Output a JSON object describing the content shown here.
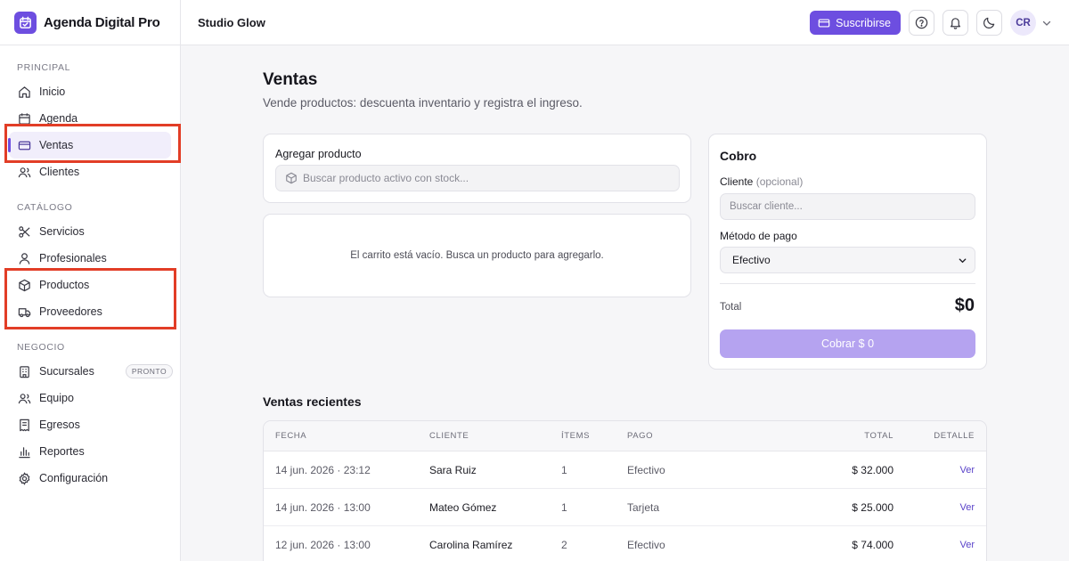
{
  "brand": {
    "name": "Agenda Digital Pro"
  },
  "topbar": {
    "studio": "Studio Glow",
    "subscribe_label": "Suscribirse",
    "avatar_initials": "CR"
  },
  "sidebar": {
    "sections": [
      {
        "label": "PRINCIPAL",
        "items": [
          {
            "label": "Inicio",
            "icon": "home-icon"
          },
          {
            "label": "Agenda",
            "icon": "calendar-icon"
          },
          {
            "label": "Ventas",
            "icon": "card-icon",
            "active": true
          },
          {
            "label": "Clientes",
            "icon": "user-icon"
          }
        ]
      },
      {
        "label": "CATÁLOGO",
        "items": [
          {
            "label": "Servicios",
            "icon": "scissors-icon"
          },
          {
            "label": "Profesionales",
            "icon": "person-icon"
          },
          {
            "label": "Productos",
            "icon": "box-icon"
          },
          {
            "label": "Proveedores",
            "icon": "truck-icon"
          }
        ]
      },
      {
        "label": "NEGOCIO",
        "items": [
          {
            "label": "Sucursales",
            "icon": "building-icon",
            "badge": "PRONTO"
          },
          {
            "label": "Equipo",
            "icon": "team-icon"
          },
          {
            "label": "Egresos",
            "icon": "receipt-icon"
          },
          {
            "label": "Reportes",
            "icon": "chart-icon"
          },
          {
            "label": "Configuración",
            "icon": "gear-icon"
          }
        ]
      }
    ]
  },
  "main": {
    "title": "Ventas",
    "subtitle": "Vende productos: descuenta inventario y registra el ingreso.",
    "add_product": {
      "label": "Agregar producto",
      "search_placeholder": "Buscar producto activo con stock..."
    },
    "cart_empty": "El carrito está vacío. Busca un producto para agregarlo.",
    "payment": {
      "title": "Cobro",
      "client_label": "Cliente",
      "client_optional": "(opcional)",
      "client_placeholder": "Buscar cliente...",
      "method_label": "Método de pago",
      "method_value": "Efectivo",
      "total_label": "Total",
      "total_value": "$0",
      "charge_button": "Cobrar $ 0"
    },
    "recent": {
      "title": "Ventas recientes",
      "columns": [
        "FECHA",
        "CLIENTE",
        "ÍTEMS",
        "PAGO",
        "TOTAL",
        "DETALLE"
      ],
      "rows": [
        {
          "fecha": "14 jun. 2026 · 23:12",
          "cliente": "Sara Ruiz",
          "items": "1",
          "pago": "Efectivo",
          "total": "$ 32.000",
          "detalle": "Ver"
        },
        {
          "fecha": "14 jun. 2026 · 13:00",
          "cliente": "Mateo Gómez",
          "items": "1",
          "pago": "Tarjeta",
          "total": "$ 25.000",
          "detalle": "Ver"
        },
        {
          "fecha": "12 jun. 2026 · 13:00",
          "cliente": "Carolina Ramírez",
          "items": "2",
          "pago": "Efectivo",
          "total": "$ 74.000",
          "detalle": "Ver"
        }
      ]
    }
  },
  "colors": {
    "accent": "#6d4ee0",
    "highlight": "#e23d26"
  }
}
